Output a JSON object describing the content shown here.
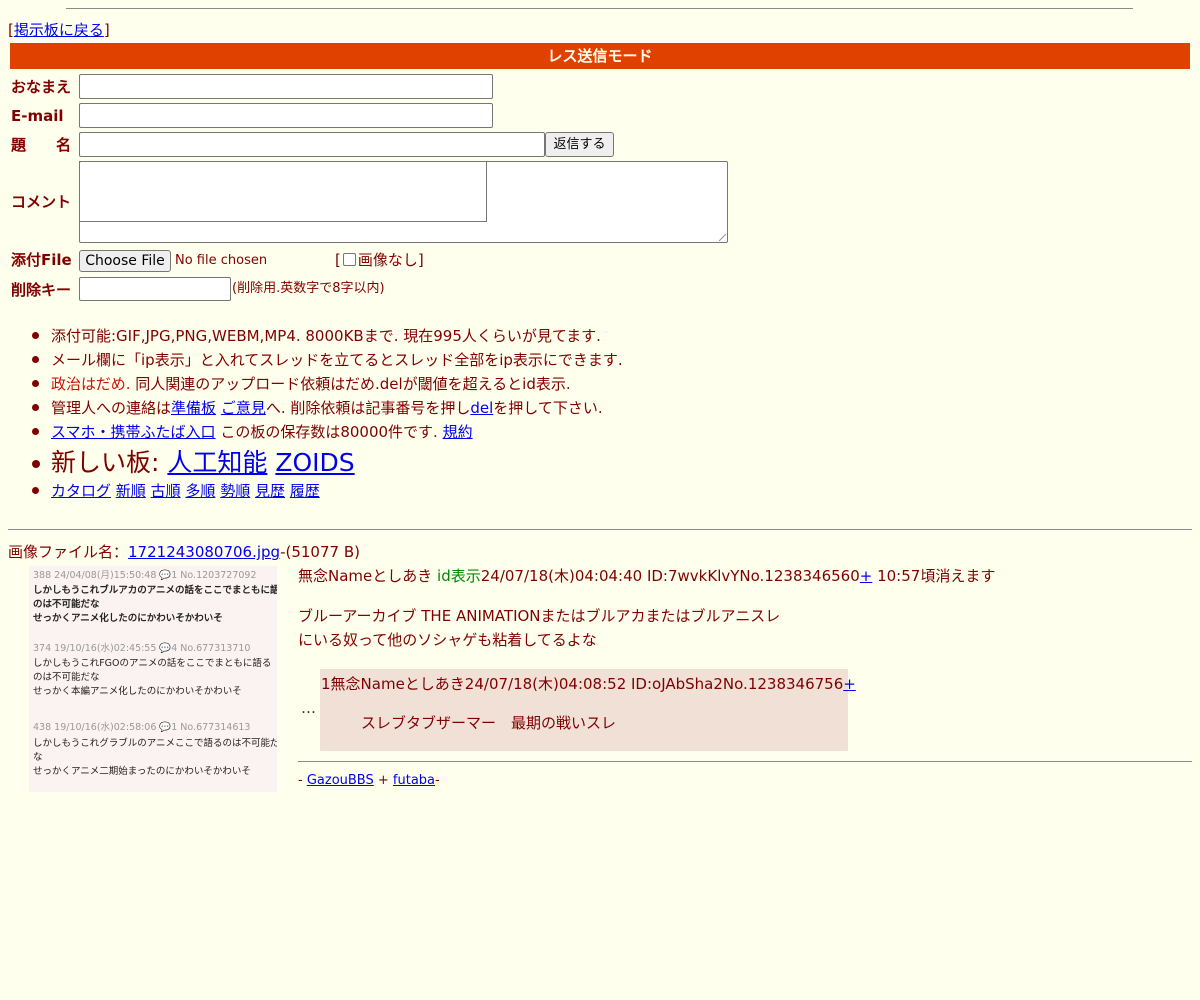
{
  "nav": {
    "bracket_open": "[",
    "back_link": "掲示板に戻る",
    "bracket_close": "]"
  },
  "banner": "レス送信モード",
  "form": {
    "name_label": "おなまえ",
    "email_label": "E-mail",
    "subject_label": "題　　名",
    "submit_button": "返信する",
    "comment_label": "コメント",
    "file_label": "添付File",
    "choose_file_button": "Choose File",
    "no_file_text": "No file chosen",
    "no_image_prefix": "[",
    "no_image_label": "画像なし]",
    "delete_key_label": "削除キー",
    "delete_key_hint": "(削除用.英数字で8字以内)"
  },
  "notices": {
    "item1": "添付可能:GIF,JPG,PNG,WEBM,MP4. 8000KBまで. 現在995人くらいが見てます.",
    "item2": "メール欄に「ip表示」と入れてスレッドを立てるとスレッド全部をip表示にできます.",
    "item3_red": "政治はだめ.",
    "item3_rest": " 同人関連のアップロード依頼はだめ.delが閾値を超えるとid表示.",
    "item4_pre": "管理人への連絡は",
    "item4_link1": "準備板",
    "item4_link2": "ご意見",
    "item4_mid": "へ. 削除依頼は記事番号を押し",
    "item4_link3": "del",
    "item4_post": "を押して下さい.",
    "item5_link": "スマホ・携帯ふたば入口",
    "item5_mid": " この板の保存数は80000件です. ",
    "item5_link2": "規約",
    "item6_pre": "新しい板: ",
    "item6_link1": "人工知能",
    "item6_link2": "ZOIDS",
    "item7_links": [
      "カタログ",
      "新順",
      "古順",
      "多順",
      "勢順",
      "見歴",
      "履歴"
    ]
  },
  "thread": {
    "file_prefix": "画像ファイル名：",
    "file_name": "1721243080706.jpg",
    "file_size": "-(51077 B)",
    "op_name": "無念Nameとしあき",
    "op_id_tag": "id表示",
    "op_meta": "24/07/18(木)04:04:40 ID:7wvkKlvYNo.1238346560",
    "op_plus": "+",
    "op_expire": " 10:57頃消えます",
    "op_body_line1": "ブルーアーカイブ THE ANIMATIONまたはブルアカまたはブルアニスレ",
    "op_body_line2": "にいる奴って他のソシャゲも粘着してるよな",
    "ellipsis": "…",
    "reply_header": "1無念Nameとしあき24/07/18(木)04:08:52 ID:oJAbSha2No.1238346756",
    "reply_plus": "+",
    "reply_body": "スレブタブザーマー　最期の戦いスレ"
  },
  "thumbnail": {
    "block1_meta": "388 24/04/08(月)15:50:48 💬1 No.1203727092",
    "block1_line1": "しかしもうこれブルアカのアニメの話をここでまともに語る",
    "block1_line2": "のは不可能だな",
    "block1_line3": "せっかくアニメ化したのにかわいそかわいそ",
    "block2_meta": "374 19/10/16(水)02:45:55 💬4 No.677313710",
    "block2_line1": "しかしもうこれFGOのアニメの話をここでまともに語る",
    "block2_line2": "のは不可能だな",
    "block2_line3": "せっかく本編アニメ化したのにかわいそかわいそ",
    "block3_meta": "438 19/10/16(水)02:58:06 💬1 No.677314613",
    "block3_line1": "しかしもうこれグラブルのアニメここで語るのは不可能だ",
    "block3_line2": "な",
    "block3_line3": "せっかくアニメ二期始まったのにかわいそかわいそ"
  },
  "footer": {
    "prefix": "- ",
    "link1": "GazouBBS",
    "sep": " + ",
    "link2": "futaba",
    "suffix": "-"
  },
  "colors": {
    "background": "#ffffee",
    "text": "#800000",
    "banner": "#e04000",
    "link": "#0000ee",
    "reply_bg": "#f0e0d6",
    "warning_red": "#cc1105",
    "id_green": "#008800"
  }
}
